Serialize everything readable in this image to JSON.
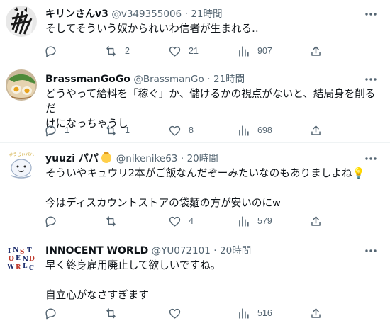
{
  "tweets": [
    {
      "name": "キリンさんv3",
      "handle": "@v349355006",
      "separator": "·",
      "time": "21時間",
      "lines": [
        "そしてそういう奴かられいわ信者が生まれる‥"
      ],
      "replies": "",
      "retweets": "2",
      "likes": "21",
      "views": "907",
      "avatar_icon": "zebra-avatar"
    },
    {
      "name": "BrassmanGoGo",
      "handle": "@BrassmanGo",
      "separator": "·",
      "time": "21時間",
      "lines": [
        "どうやって給料を「稼ぐ」か、儲けるかの視点がないと、結局身を削るだ",
        "けになっちゃうし"
      ],
      "replies": "1",
      "retweets": "1",
      "likes": "8",
      "views": "698",
      "avatar_icon": "ramen-avatar"
    },
    {
      "name": "yuuzi パパ",
      "handle": "@nikenike63",
      "separator": "·",
      "time": "20時間",
      "lines": [
        "そういやキュウリ2本がご飯なんだぞーみたいなのもありましよね💡",
        "",
        "今はディスカウントストアの袋麺の方が安いのにw"
      ],
      "replies": "",
      "retweets": "",
      "likes": "4",
      "views": "579",
      "avatar_icon": "mascot-avatar",
      "avatar_text": "ゆうじぃパパ"
    },
    {
      "name": "INNOCENT WORLD",
      "handle": "@YU072101",
      "separator": "·",
      "time": "20時間",
      "lines": [
        "早く終身雇用廃止して欲しいですね。",
        "",
        "自立心がなさすぎます"
      ],
      "replies": "",
      "retweets": "",
      "likes": "",
      "views": "516",
      "avatar_icon": "innocent-world-logo-avatar"
    }
  ],
  "colors": {
    "text": "#0f1419",
    "secondary": "#536471",
    "divider": "#eff3f4"
  }
}
